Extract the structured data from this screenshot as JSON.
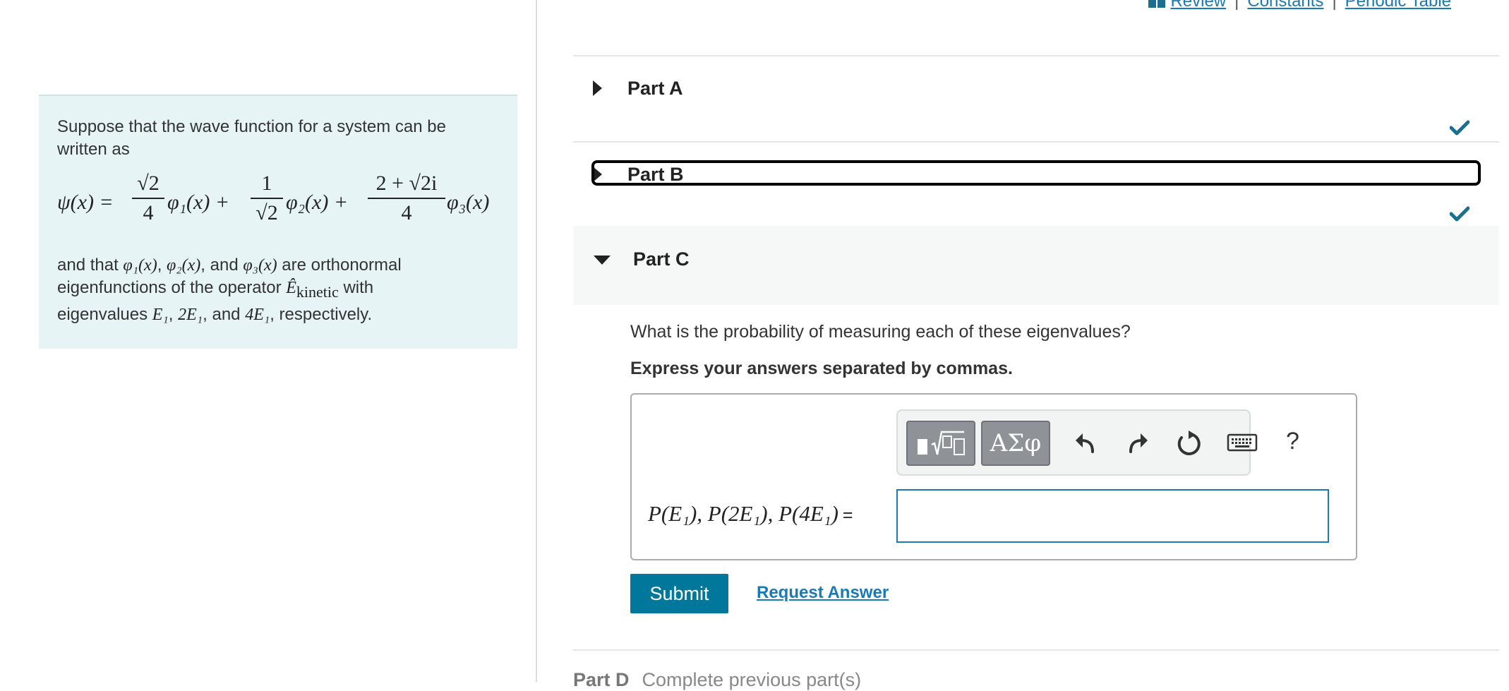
{
  "top_links": {
    "review": "Review",
    "constants": "Constants",
    "periodic_table": "Periodic Table",
    "separator": "|"
  },
  "problem": {
    "intro": "Suppose that the wave function for a system can be written as",
    "equation": {
      "lhs": "ψ(x) =",
      "term1_num": "√2",
      "term1_den": "4",
      "term1_func": "φ₁(x) +",
      "term2_num": "1",
      "term2_den": "√2",
      "term2_func": "φ₂(x) +",
      "term3_num": "2 + √2i",
      "term3_den": "4",
      "term3_func": "φ₃(x)"
    },
    "line1_a": "and that ",
    "line1_phi1": "φ₁(x)",
    "line1_b": ", ",
    "line1_phi2": "φ₂(x)",
    "line1_c": ", and ",
    "line1_phi3": "φ₃(x)",
    "line1_d": " are orthonormal",
    "line2_a": "eigenfunctions of the operator ",
    "line2_op": "Ê",
    "line2_sub": "kinetic",
    "line2_b": " with",
    "line3_a": "eigenvalues ",
    "line3_e1": "E₁",
    "line3_b": ", ",
    "line3_e2": "2E₁",
    "line3_c": ", and ",
    "line3_e3": "4E₁",
    "line3_d": ", respectively."
  },
  "parts": {
    "part_a": {
      "title": "Part A",
      "completed": true
    },
    "part_b": {
      "title": "Part B",
      "completed": true
    },
    "part_c": {
      "title": "Part C",
      "question": "What is the probability of measuring each of these eigenvalues?",
      "instruction": "Express your answers separated by commas.",
      "answer_label": "P(E₁), P(2E₁), P(4E₁)",
      "equals": "=",
      "answer_value": "",
      "submit_label": "Submit",
      "request_answer_label": "Request Answer"
    },
    "part_d": {
      "title": "Part D",
      "status": "Complete previous part(s)"
    }
  },
  "toolbar": {
    "greek_label": "ΑΣφ",
    "help_label": "?"
  },
  "colors": {
    "accent": "#00779b",
    "link": "#1a7ab6",
    "check": "#1a6e8e",
    "problem_bg": "#e6f4f5"
  }
}
